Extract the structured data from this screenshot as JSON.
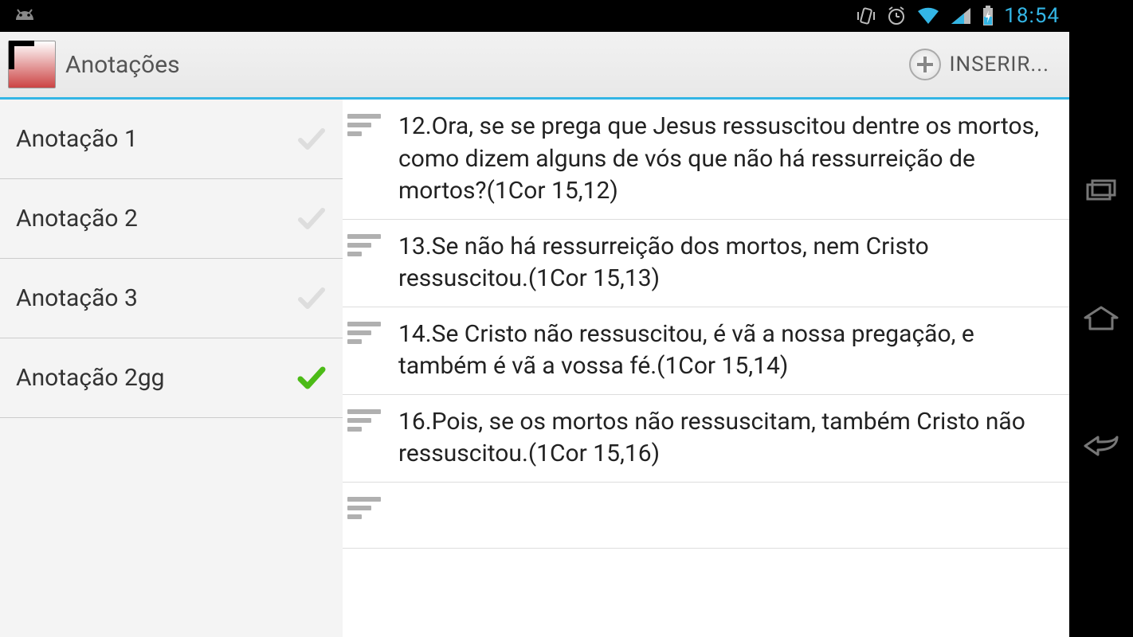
{
  "status": {
    "time": "18:54"
  },
  "actionbar": {
    "title": "Anotações",
    "insert_label": "INSERIR..."
  },
  "sidebar": {
    "items": [
      {
        "label": "Anotação 1",
        "selected": false
      },
      {
        "label": "Anotação 2",
        "selected": false
      },
      {
        "label": "Anotação 3",
        "selected": false
      },
      {
        "label": "Anotação 2gg",
        "selected": true
      }
    ]
  },
  "notes": [
    {
      "text": "12.Ora, se se prega que Jesus ressuscitou dentre os mortos, como dizem alguns de vós que não há ressurreição de mortos?(1Cor 15,12)"
    },
    {
      "text": "13.Se não há ressurreição dos mortos, nem Cristo ressuscitou.(1Cor 15,13)"
    },
    {
      "text": "14.Se Cristo não ressuscitou, é vã a nossa pregação, e também é vã a vossa fé.(1Cor 15,14)"
    },
    {
      "text": "16.Pois, se os mortos não ressuscitam, também Cristo não ressuscitou.(1Cor 15,16)"
    }
  ]
}
